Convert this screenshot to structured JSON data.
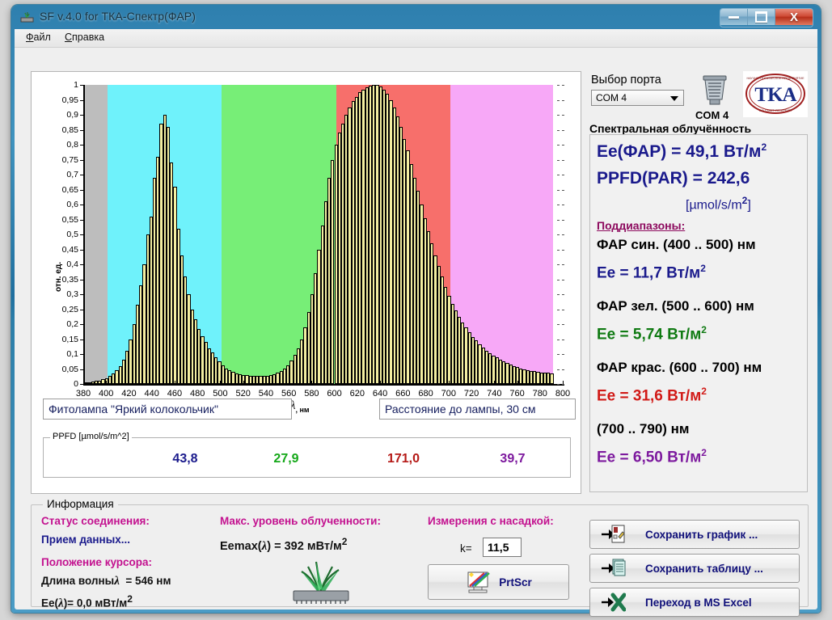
{
  "window": {
    "title": "SF v.4.0 for ТКА-Спектр(ФАР)",
    "minimize_label": "—",
    "maximize_label": "□",
    "close_label": "X"
  },
  "menu": {
    "items": [
      {
        "label": "Файл"
      },
      {
        "label": "Справка"
      }
    ]
  },
  "port": {
    "label": "Выбор порта",
    "selected": "COM 4",
    "status": "COM  4",
    "logo_text": "ТКА"
  },
  "spectral": {
    "heading": "Спектральная облучённость",
    "ee_par": "Ee(ФАР) = 49,1 Вт/м",
    "ee_par_sup": "2",
    "ppfd_par": "PPFD(PAR) = 242,6",
    "ppfd_units": "[µmol/s/m",
    "ppfd_units_sup": "2",
    "ppfd_units_end": "]",
    "subranges_label": "Поддиапазоны:",
    "ranges": [
      {
        "name": "ФАР син. (400 .. 500) нм",
        "value": "Ee = 11,7 Вт/м",
        "sup": "2",
        "color": "#1a1a8c"
      },
      {
        "name": "ФАР зел. (500 .. 600) нм",
        "value": "Ee = 5,74 Вт/м",
        "sup": "2",
        "color": "#0f7a12"
      },
      {
        "name": "ФАР крас. (600 .. 700) нм",
        "value": "Ee = 31,6 Вт/м",
        "sup": "2",
        "color": "#d11a17"
      },
      {
        "name": "(700 .. 790) нм",
        "value": "Ee = 6,50 Вт/м",
        "sup": "2",
        "color": "#7d1a9e"
      }
    ]
  },
  "chart_meta": {
    "lamp_name": "Фитолампа \"Яркий колокольчик\"",
    "distance": "Расстояние до лампы, 30 см",
    "ppfd_legend": "PPFD [µmol/s/m^2]",
    "ppfd_values": [
      {
        "value": "43,8",
        "color": "#1a1a8c"
      },
      {
        "value": "27,9",
        "color": "#15a819"
      },
      {
        "value": "171,0",
        "color": "#b51a17"
      },
      {
        "value": "39,7",
        "color": "#7d1a9e"
      }
    ]
  },
  "info": {
    "legend": "Информация",
    "conn_status_label": "Статус соединения:",
    "conn_status_value": "Прием данных...",
    "cursor_label": "Положение курсора:",
    "wavelength_label": "Длина волны",
    "wavelength_value": "= 546 нм",
    "ee_cursor_label": "Ee(",
    "ee_cursor_value": ")= 0,0 мВт/м",
    "ee_cursor_sup": "2",
    "max_label": "Макс. уровень облученности:",
    "max_value_pre": "Eemax(",
    "max_value_post": ") = 392 мВт/м",
    "max_value_sup": "2",
    "nozzle_label": "Измерения с насадкой:",
    "k_label": "k=",
    "k_value": "11,5",
    "prtscr_label": "PrtScr"
  },
  "actions": [
    {
      "label": "Сохранить график ...",
      "icon": "save-chart-icon"
    },
    {
      "label": "Сохранить таблицу ...",
      "icon": "save-table-icon"
    },
    {
      "label": "Переход в MS Excel",
      "icon": "excel-icon"
    }
  ],
  "chart_data": {
    "type": "bar",
    "title": "",
    "xlabel": "λ, нм",
    "ylabel": "отн. ед.",
    "xlim": [
      380,
      800
    ],
    "ylim": [
      0,
      1
    ],
    "xticks": [
      380,
      400,
      420,
      440,
      460,
      480,
      500,
      520,
      540,
      560,
      580,
      600,
      620,
      640,
      660,
      680,
      700,
      720,
      740,
      760,
      780,
      800
    ],
    "yticks": [
      0,
      0.05,
      0.1,
      0.15,
      0.2,
      0.25,
      0.3,
      0.35,
      0.4,
      0.45,
      0.5,
      0.55,
      0.6,
      0.65,
      0.7,
      0.75,
      0.8,
      0.85,
      0.9,
      0.95,
      1
    ],
    "ytick_labels": [
      "0",
      "0,05",
      "0,1",
      "0,15",
      "0,2",
      "0,25",
      "0,3",
      "0,35",
      "0,4",
      "0,45",
      "0,5",
      "0,55",
      "0,6",
      "0,65",
      "0,7",
      "0,75",
      "0,8",
      "0,85",
      "0,9",
      "0,95",
      "1"
    ],
    "grid": "dashed-right-edge",
    "legend": "none",
    "bar_fill": "#f3eea1",
    "bar_edge": "#000000",
    "bands": [
      {
        "name": "uv-gray",
        "from": 380,
        "to": 400,
        "color": "#bdbdbd"
      },
      {
        "name": "blue-par",
        "from": 400,
        "to": 500,
        "color": "#6ff2fb"
      },
      {
        "name": "green-par",
        "from": 500,
        "to": 600,
        "color": "#77ee77"
      },
      {
        "name": "red-par",
        "from": 600,
        "to": 700,
        "color": "#f76f6b"
      },
      {
        "name": "far-red",
        "from": 700,
        "to": 790,
        "color": "#f7a8f7"
      },
      {
        "name": "beyond",
        "from": 790,
        "to": 800,
        "color": "#ffffff"
      }
    ],
    "x": [
      381,
      384,
      387,
      390,
      393,
      396,
      399,
      402,
      405,
      408,
      411,
      414,
      417,
      420,
      423,
      426,
      429,
      432,
      435,
      438,
      441,
      444,
      447,
      450,
      453,
      456,
      459,
      462,
      465,
      468,
      471,
      474,
      477,
      480,
      483,
      486,
      489,
      492,
      495,
      498,
      501,
      504,
      507,
      510,
      513,
      516,
      519,
      522,
      525,
      528,
      531,
      534,
      537,
      540,
      543,
      546,
      549,
      552,
      555,
      558,
      561,
      564,
      567,
      570,
      573,
      576,
      579,
      582,
      585,
      588,
      591,
      594,
      597,
      600,
      603,
      606,
      609,
      612,
      615,
      618,
      621,
      624,
      627,
      630,
      633,
      636,
      639,
      642,
      645,
      648,
      651,
      654,
      657,
      660,
      663,
      666,
      669,
      672,
      675,
      678,
      681,
      684,
      687,
      690,
      693,
      696,
      699,
      702,
      705,
      708,
      711,
      714,
      717,
      720,
      723,
      726,
      729,
      732,
      735,
      738,
      741,
      744,
      747,
      750,
      753,
      756,
      759,
      762,
      765,
      768,
      771,
      774,
      777,
      780,
      783,
      786,
      789
    ],
    "values": [
      0.005,
      0.006,
      0.008,
      0.01,
      0.012,
      0.016,
      0.02,
      0.026,
      0.034,
      0.045,
      0.06,
      0.082,
      0.11,
      0.15,
      0.2,
      0.265,
      0.33,
      0.4,
      0.5,
      0.56,
      0.69,
      0.76,
      0.87,
      0.9,
      0.86,
      0.74,
      0.66,
      0.52,
      0.43,
      0.36,
      0.3,
      0.25,
      0.215,
      0.185,
      0.16,
      0.14,
      0.12,
      0.105,
      0.09,
      0.075,
      0.062,
      0.052,
      0.045,
      0.04,
      0.036,
      0.033,
      0.031,
      0.029,
      0.028,
      0.027,
      0.026,
      0.026,
      0.027,
      0.028,
      0.03,
      0.033,
      0.037,
      0.043,
      0.052,
      0.063,
      0.078,
      0.096,
      0.12,
      0.15,
      0.19,
      0.24,
      0.3,
      0.37,
      0.45,
      0.53,
      0.61,
      0.69,
      0.75,
      0.8,
      0.84,
      0.87,
      0.9,
      0.925,
      0.945,
      0.96,
      0.975,
      0.985,
      0.993,
      0.998,
      1.0,
      1.0,
      0.995,
      0.985,
      0.97,
      0.95,
      0.925,
      0.895,
      0.86,
      0.82,
      0.78,
      0.735,
      0.69,
      0.645,
      0.6,
      0.555,
      0.51,
      0.47,
      0.43,
      0.395,
      0.36,
      0.325,
      0.295,
      0.268,
      0.245,
      0.225,
      0.205,
      0.188,
      0.172,
      0.158,
      0.145,
      0.133,
      0.122,
      0.112,
      0.103,
      0.095,
      0.088,
      0.081,
      0.075,
      0.069,
      0.064,
      0.06,
      0.056,
      0.052,
      0.049,
      0.046,
      0.044,
      0.042,
      0.04,
      0.039,
      0.038,
      0.037,
      0.036
    ]
  }
}
